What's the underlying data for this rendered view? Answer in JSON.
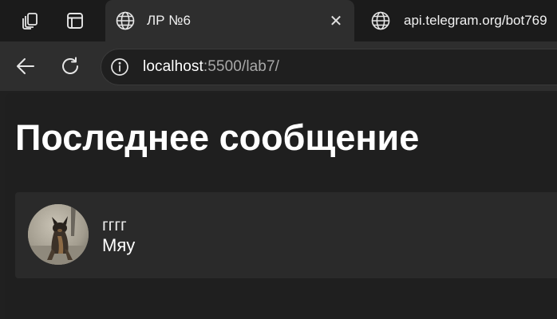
{
  "browser": {
    "tabs": [
      {
        "title": "ЛР №6",
        "active": true,
        "icon": "globe-icon"
      },
      {
        "title": "api.telegram.org/bot769",
        "active": false,
        "icon": "globe-icon"
      }
    ],
    "toolbar_icons": [
      "workspaces-icon",
      "tab-actions-icon"
    ],
    "close_glyph": "✕"
  },
  "toolbar": {
    "url_host": "localhost",
    "url_rest": ":5500/lab7/"
  },
  "page": {
    "title": "Последнее сообщение",
    "message": {
      "author": "гггг",
      "text": "Мяу",
      "avatar": "dog-photo"
    }
  },
  "colors": {
    "tabstrip": "#1b1b1b",
    "toolbar": "#2e2e2e",
    "page_bg": "#1f1f1f",
    "card_bg": "#2a2a2a",
    "text": "#ffffff",
    "url_dim": "#a8a8a8"
  }
}
